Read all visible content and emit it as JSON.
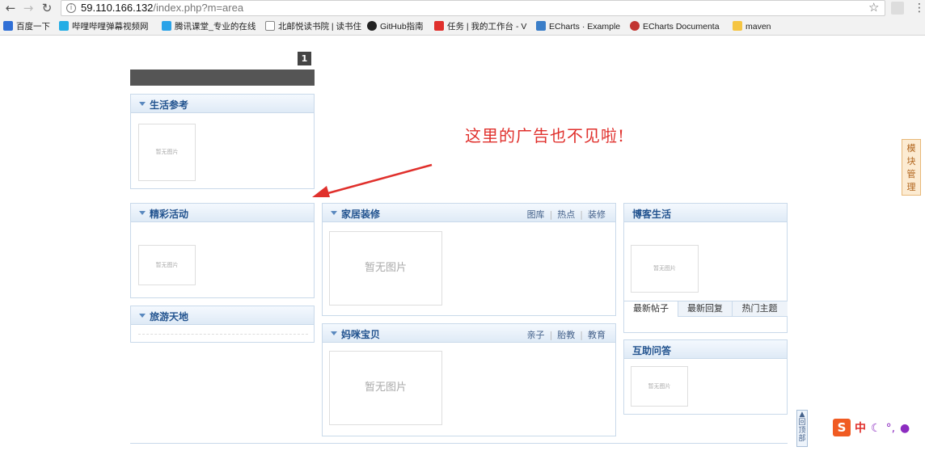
{
  "browser": {
    "url_host": "59.110.166.132",
    "url_path": "/index.php?m=area",
    "bookmarks": [
      {
        "label": "百度一下",
        "color": "#2f6fd6"
      },
      {
        "label": "哔哩哔哩弹幕视频网",
        "color": "#23ade5"
      },
      {
        "label": "腾讯课堂_专业的在线",
        "color": "#2aa3e8"
      },
      {
        "label": "北邮悦读书院 | 读书住",
        "color": "#888888"
      },
      {
        "label": "GitHub指南",
        "color": "#222222"
      },
      {
        "label": "任务 | 我的工作台 - V",
        "color": "#e0302c"
      },
      {
        "label": "ECharts · Example",
        "color": "#3b7ec8"
      },
      {
        "label": "ECharts Documenta",
        "color": "#c23531"
      },
      {
        "label": "maven",
        "color": "#f5c542"
      }
    ]
  },
  "page": {
    "page_number": "1",
    "no_image": "暂无图片",
    "annotation": "这里的广告也不见啦!",
    "side_tab": [
      "模",
      "块",
      "管",
      "理"
    ],
    "back_top": [
      "回",
      "顶",
      "部"
    ],
    "sections": {
      "life_ref": {
        "title": "生活参考"
      },
      "events": {
        "title": "精彩活动"
      },
      "travel": {
        "title": "旅游天地"
      },
      "home": {
        "title": "家居装修",
        "links": [
          "图库",
          "热点",
          "装修"
        ]
      },
      "baby": {
        "title": "妈咪宝贝",
        "links": [
          "亲子",
          "胎教",
          "教育"
        ]
      },
      "blog": {
        "title": "博客生活",
        "tabs": [
          "最新帖子",
          "最新回复",
          "热门主题"
        ]
      },
      "qa": {
        "title": "互助问答"
      }
    },
    "ime": {
      "zh": "中"
    }
  }
}
